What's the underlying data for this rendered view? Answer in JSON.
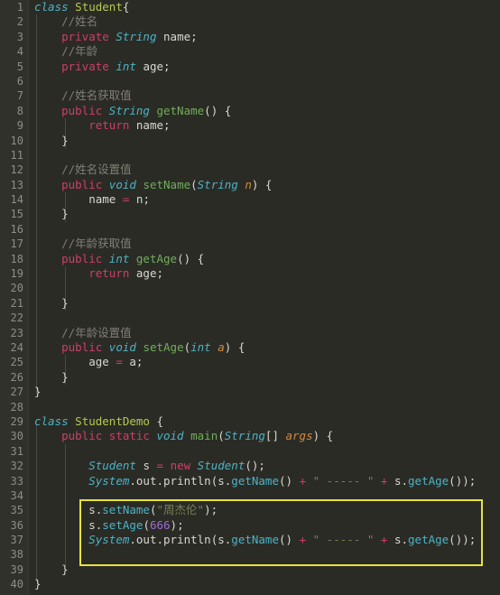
{
  "editor": {
    "name": "java-code-editor",
    "background_color": "#2b2b26",
    "gutter_color": "#31312c",
    "total_lines": 40,
    "font_size_px": 12.5,
    "line_height_px": 16.4
  },
  "colors": {
    "keyword": "#cc3f68",
    "type": "#4cb3c4",
    "class_name": "#b5c94f",
    "method_decl": "#6fae5a",
    "method_call": "#4cb3c4",
    "comment": "#7f7f74",
    "string": "#7a7f55",
    "number": "#9a6fd0",
    "operator": "#cc3f68",
    "parameter": "#d08a3a",
    "plain": "#d8d8d0",
    "highlight_border": "#e3e342",
    "line_number": "#8e8e82"
  },
  "gutter": {
    "line_numbers": [
      "1",
      "2",
      "3",
      "4",
      "5",
      "6",
      "7",
      "8",
      "9",
      "10",
      "11",
      "12",
      "13",
      "14",
      "15",
      "16",
      "17",
      "18",
      "19",
      "20",
      "21",
      "22",
      "23",
      "24",
      "25",
      "26",
      "27",
      "28",
      "29",
      "30",
      "31",
      "32",
      "33",
      "34",
      "35",
      "36",
      "37",
      "38",
      "39",
      "40"
    ]
  },
  "highlight_box": {
    "label": "annotation-rectangle",
    "covers_lines": "35-38",
    "border_color": "#e3e342"
  },
  "code": {
    "lines": [
      {
        "n": 1,
        "text": "class Student{"
      },
      {
        "n": 2,
        "text": "    //姓名"
      },
      {
        "n": 3,
        "text": "    private String name;"
      },
      {
        "n": 4,
        "text": "    //年龄"
      },
      {
        "n": 5,
        "text": "    private int age;"
      },
      {
        "n": 6,
        "text": ""
      },
      {
        "n": 7,
        "text": "    //姓名获取值"
      },
      {
        "n": 8,
        "text": "    public String getName() {"
      },
      {
        "n": 9,
        "text": "        return name;"
      },
      {
        "n": 10,
        "text": "    }"
      },
      {
        "n": 11,
        "text": ""
      },
      {
        "n": 12,
        "text": "    //姓名设置值"
      },
      {
        "n": 13,
        "text": "    public void setName(String n) {"
      },
      {
        "n": 14,
        "text": "        name = n;"
      },
      {
        "n": 15,
        "text": "    }"
      },
      {
        "n": 16,
        "text": ""
      },
      {
        "n": 17,
        "text": "    //年龄获取值"
      },
      {
        "n": 18,
        "text": "    public int getAge() {"
      },
      {
        "n": 19,
        "text": "        return age;"
      },
      {
        "n": 20,
        "text": ""
      },
      {
        "n": 21,
        "text": "    }"
      },
      {
        "n": 22,
        "text": ""
      },
      {
        "n": 23,
        "text": "    //年龄设置值"
      },
      {
        "n": 24,
        "text": "    public void setAge(int a) {"
      },
      {
        "n": 25,
        "text": "        age = a;"
      },
      {
        "n": 26,
        "text": "    }"
      },
      {
        "n": 27,
        "text": "}"
      },
      {
        "n": 28,
        "text": ""
      },
      {
        "n": 29,
        "text": "class StudentDemo {"
      },
      {
        "n": 30,
        "text": "    public static void main(String[] args) {"
      },
      {
        "n": 31,
        "text": ""
      },
      {
        "n": 32,
        "text": "        Student s = new Student();"
      },
      {
        "n": 33,
        "text": "        System.out.println(s.getName() + \" ----- \" + s.getAge());"
      },
      {
        "n": 34,
        "text": ""
      },
      {
        "n": 35,
        "text": "        s.setName(\"周杰伦\");"
      },
      {
        "n": 36,
        "text": "        s.setAge(666);"
      },
      {
        "n": 37,
        "text": "        System.out.println(s.getName() + \" ----- \" + s.getAge());"
      },
      {
        "n": 38,
        "text": ""
      },
      {
        "n": 39,
        "text": "    }"
      },
      {
        "n": 40,
        "text": "}"
      }
    ]
  },
  "tokens": {
    "l1": [
      [
        "class",
        "type"
      ],
      [
        " ",
        "par"
      ],
      [
        "Student",
        "cls"
      ],
      [
        "{",
        "par"
      ]
    ],
    "l2": [
      [
        "    ",
        "par"
      ],
      [
        "//姓名",
        "cmt"
      ]
    ],
    "l3": [
      [
        "    ",
        "par"
      ],
      [
        "private",
        "kw"
      ],
      [
        " ",
        "par"
      ],
      [
        "String",
        "type"
      ],
      [
        " ",
        "par"
      ],
      [
        "name",
        "var"
      ],
      [
        ";",
        "par"
      ]
    ],
    "l4": [
      [
        "    ",
        "par"
      ],
      [
        "//年龄",
        "cmt"
      ]
    ],
    "l5": [
      [
        "    ",
        "par"
      ],
      [
        "private",
        "kw"
      ],
      [
        " ",
        "par"
      ],
      [
        "int",
        "type"
      ],
      [
        " ",
        "par"
      ],
      [
        "age",
        "var"
      ],
      [
        ";",
        "par"
      ]
    ],
    "l6": [],
    "l7": [
      [
        "    ",
        "par"
      ],
      [
        "//姓名获取值",
        "cmt"
      ]
    ],
    "l8": [
      [
        "    ",
        "par"
      ],
      [
        "public",
        "kw"
      ],
      [
        " ",
        "par"
      ],
      [
        "String",
        "type"
      ],
      [
        " ",
        "par"
      ],
      [
        "getName",
        "mth"
      ],
      [
        "() {",
        "par"
      ]
    ],
    "l9": [
      [
        "        ",
        "par"
      ],
      [
        "return",
        "kw"
      ],
      [
        " ",
        "par"
      ],
      [
        "name",
        "var"
      ],
      [
        ";",
        "par"
      ]
    ],
    "l10": [
      [
        "    }",
        "par"
      ]
    ],
    "l11": [],
    "l12": [
      [
        "    ",
        "par"
      ],
      [
        "//姓名设置值",
        "cmt"
      ]
    ],
    "l13": [
      [
        "    ",
        "par"
      ],
      [
        "public",
        "kw"
      ],
      [
        " ",
        "par"
      ],
      [
        "void",
        "type"
      ],
      [
        " ",
        "par"
      ],
      [
        "setName",
        "mth"
      ],
      [
        "(",
        "par"
      ],
      [
        "String",
        "type"
      ],
      [
        " ",
        "par"
      ],
      [
        "n",
        "parm"
      ],
      [
        ") {",
        "par"
      ]
    ],
    "l14": [
      [
        "        ",
        "par"
      ],
      [
        "name",
        "var"
      ],
      [
        " ",
        "par"
      ],
      [
        "=",
        "op"
      ],
      [
        " ",
        "par"
      ],
      [
        "n",
        "var"
      ],
      [
        ";",
        "par"
      ]
    ],
    "l15": [
      [
        "    }",
        "par"
      ]
    ],
    "l16": [],
    "l17": [
      [
        "    ",
        "par"
      ],
      [
        "//年龄获取值",
        "cmt"
      ]
    ],
    "l18": [
      [
        "    ",
        "par"
      ],
      [
        "public",
        "kw"
      ],
      [
        " ",
        "par"
      ],
      [
        "int",
        "type"
      ],
      [
        " ",
        "par"
      ],
      [
        "getAge",
        "mth"
      ],
      [
        "() {",
        "par"
      ]
    ],
    "l19": [
      [
        "        ",
        "par"
      ],
      [
        "return",
        "kw"
      ],
      [
        " ",
        "par"
      ],
      [
        "age",
        "var"
      ],
      [
        ";",
        "par"
      ]
    ],
    "l20": [],
    "l21": [
      [
        "    }",
        "par"
      ]
    ],
    "l22": [],
    "l23": [
      [
        "    ",
        "par"
      ],
      [
        "//年龄设置值",
        "cmt"
      ]
    ],
    "l24": [
      [
        "    ",
        "par"
      ],
      [
        "public",
        "kw"
      ],
      [
        " ",
        "par"
      ],
      [
        "void",
        "type"
      ],
      [
        " ",
        "par"
      ],
      [
        "setAge",
        "mth"
      ],
      [
        "(",
        "par"
      ],
      [
        "int",
        "type"
      ],
      [
        " ",
        "par"
      ],
      [
        "a",
        "parm"
      ],
      [
        ") {",
        "par"
      ]
    ],
    "l25": [
      [
        "        ",
        "par"
      ],
      [
        "age",
        "var"
      ],
      [
        " ",
        "par"
      ],
      [
        "=",
        "op"
      ],
      [
        " ",
        "par"
      ],
      [
        "a",
        "var"
      ],
      [
        ";",
        "par"
      ]
    ],
    "l26": [
      [
        "    }",
        "par"
      ]
    ],
    "l27": [
      [
        "}",
        "par"
      ]
    ],
    "l28": [],
    "l29": [
      [
        "class",
        "type"
      ],
      [
        " ",
        "par"
      ],
      [
        "StudentDemo",
        "cls"
      ],
      [
        " {",
        "par"
      ]
    ],
    "l30": [
      [
        "    ",
        "par"
      ],
      [
        "public",
        "kw"
      ],
      [
        " ",
        "par"
      ],
      [
        "static",
        "kw"
      ],
      [
        " ",
        "par"
      ],
      [
        "void",
        "type"
      ],
      [
        " ",
        "par"
      ],
      [
        "main",
        "mth"
      ],
      [
        "(",
        "par"
      ],
      [
        "String",
        "type"
      ],
      [
        "[] ",
        "par"
      ],
      [
        "args",
        "parm"
      ],
      [
        ") {",
        "par"
      ]
    ],
    "l31": [],
    "l32": [
      [
        "        ",
        "par"
      ],
      [
        "Student",
        "type"
      ],
      [
        " ",
        "par"
      ],
      [
        "s",
        "var"
      ],
      [
        " ",
        "par"
      ],
      [
        "=",
        "op"
      ],
      [
        " ",
        "par"
      ],
      [
        "new",
        "kw"
      ],
      [
        " ",
        "par"
      ],
      [
        "Student",
        "type"
      ],
      [
        "();",
        "par"
      ]
    ],
    "l33": [
      [
        "        ",
        "par"
      ],
      [
        "System",
        "type"
      ],
      [
        ".",
        "par"
      ],
      [
        "out",
        "var"
      ],
      [
        ".",
        "par"
      ],
      [
        "println",
        "var"
      ],
      [
        "(",
        "par"
      ],
      [
        "s",
        "var"
      ],
      [
        ".",
        "par"
      ],
      [
        "getName",
        "call"
      ],
      [
        "() ",
        "par"
      ],
      [
        "+",
        "op"
      ],
      [
        " ",
        "par"
      ],
      [
        "\" ----- \"",
        "str"
      ],
      [
        " ",
        "par"
      ],
      [
        "+",
        "op"
      ],
      [
        " ",
        "par"
      ],
      [
        "s",
        "var"
      ],
      [
        ".",
        "par"
      ],
      [
        "getAge",
        "call"
      ],
      [
        "());",
        "par"
      ]
    ],
    "l34": [],
    "l35": [
      [
        "        ",
        "par"
      ],
      [
        "s",
        "var"
      ],
      [
        ".",
        "par"
      ],
      [
        "setName",
        "call"
      ],
      [
        "(",
        "par"
      ],
      [
        "\"周杰伦\"",
        "str"
      ],
      [
        ");",
        "par"
      ]
    ],
    "l36": [
      [
        "        ",
        "par"
      ],
      [
        "s",
        "var"
      ],
      [
        ".",
        "par"
      ],
      [
        "setAge",
        "call"
      ],
      [
        "(",
        "par"
      ],
      [
        "666",
        "num"
      ],
      [
        ");",
        "par"
      ]
    ],
    "l37": [
      [
        "        ",
        "par"
      ],
      [
        "System",
        "type"
      ],
      [
        ".",
        "par"
      ],
      [
        "out",
        "var"
      ],
      [
        ".",
        "par"
      ],
      [
        "println",
        "var"
      ],
      [
        "(",
        "par"
      ],
      [
        "s",
        "var"
      ],
      [
        ".",
        "par"
      ],
      [
        "getName",
        "call"
      ],
      [
        "() ",
        "par"
      ],
      [
        "+",
        "op"
      ],
      [
        " ",
        "par"
      ],
      [
        "\" ----- \"",
        "str"
      ],
      [
        " ",
        "par"
      ],
      [
        "+",
        "op"
      ],
      [
        " ",
        "par"
      ],
      [
        "s",
        "var"
      ],
      [
        ".",
        "par"
      ],
      [
        "getAge",
        "call"
      ],
      [
        "());",
        "par"
      ]
    ],
    "l38": [],
    "l39": [
      [
        "    }",
        "par"
      ]
    ],
    "l40": [
      [
        "}",
        "par"
      ]
    ]
  }
}
